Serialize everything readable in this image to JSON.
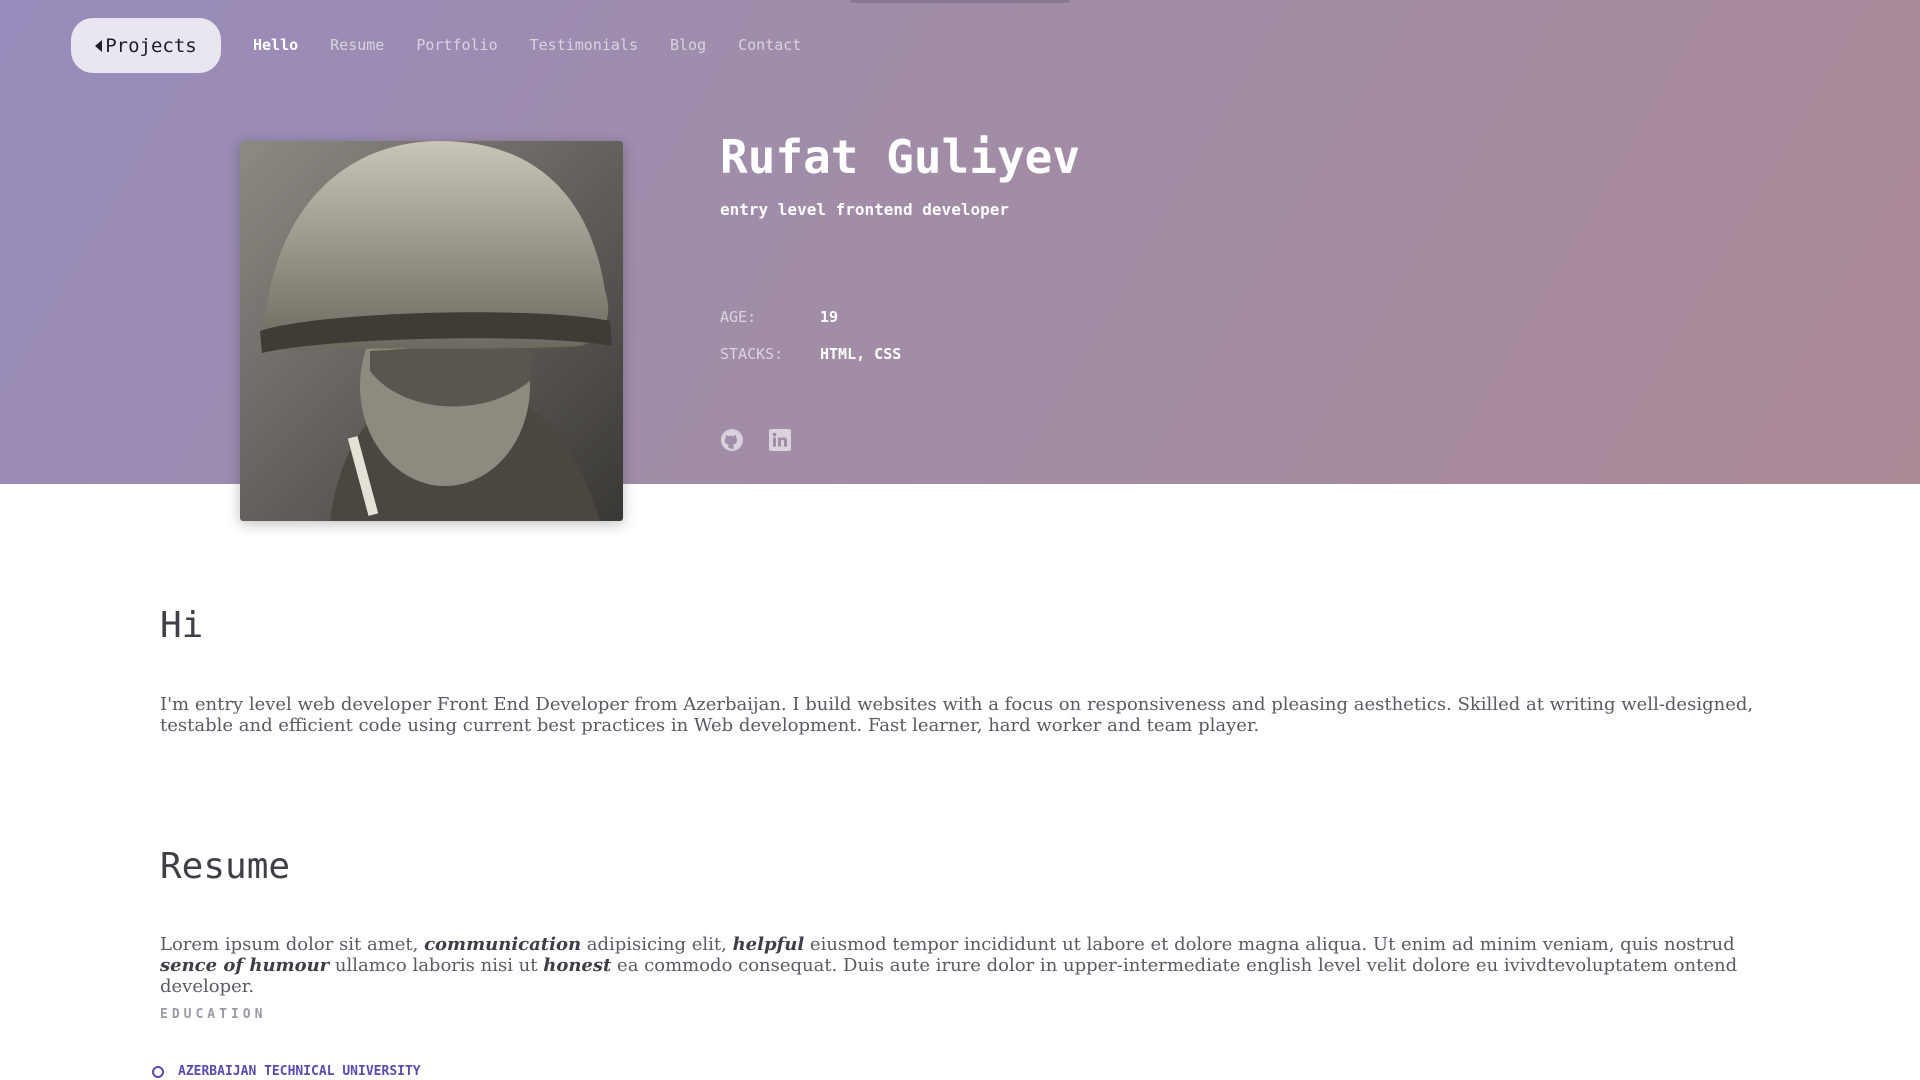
{
  "nav": {
    "projects_label": "Projects",
    "items": [
      {
        "label": "Hello"
      },
      {
        "label": "Resume"
      },
      {
        "label": "Portfolio"
      },
      {
        "label": "Testimonials"
      },
      {
        "label": "Blog"
      },
      {
        "label": "Contact"
      }
    ]
  },
  "profile": {
    "name": "Rufat Guliyev",
    "role": "entry level frontend developer",
    "age_label": "AGE:",
    "age_value": "19",
    "stacks_label": "STACKS:",
    "stacks_value": "HTML, CSS",
    "social_icons": [
      "github-icon",
      "linkedin-icon"
    ]
  },
  "hi": {
    "heading": "Hi",
    "text": "I'm entry level web developer Front End Developer from Azerbaijan. I build websites with a focus on responsiveness and pleasing aesthetics. Skilled at writing well-designed, testable and efficient code using current best practices in Web development. Fast learner, hard worker and team player."
  },
  "resume": {
    "heading": "Resume",
    "p1": "Lorem ipsum dolor sit amet, ",
    "b1": "communication",
    "p2": " adipisicing elit, ",
    "b2": "helpful",
    "p3": " eiusmod tempor incididunt ut labore et dolore magna aliqua. Ut enim ad minim veniam, quis nostrud ",
    "b3": "sence of humour",
    "p4": " ullamco laboris nisi ut ",
    "b4": "honest",
    "p5": " ea commodo consequat. Duis aute irure dolor in upper-intermediate english level velit dolore eu ivivdtevoluptatem ontend developer.",
    "education_heading": "EDUCATION",
    "education": [
      {
        "school": "AZERBAIJAN TECHNICAL UNIVERSITY"
      }
    ]
  },
  "colors": {
    "hero_gradient_start": "#978cbc",
    "hero_gradient_end": "#ab8a97",
    "accent": "#5b4ab0"
  }
}
